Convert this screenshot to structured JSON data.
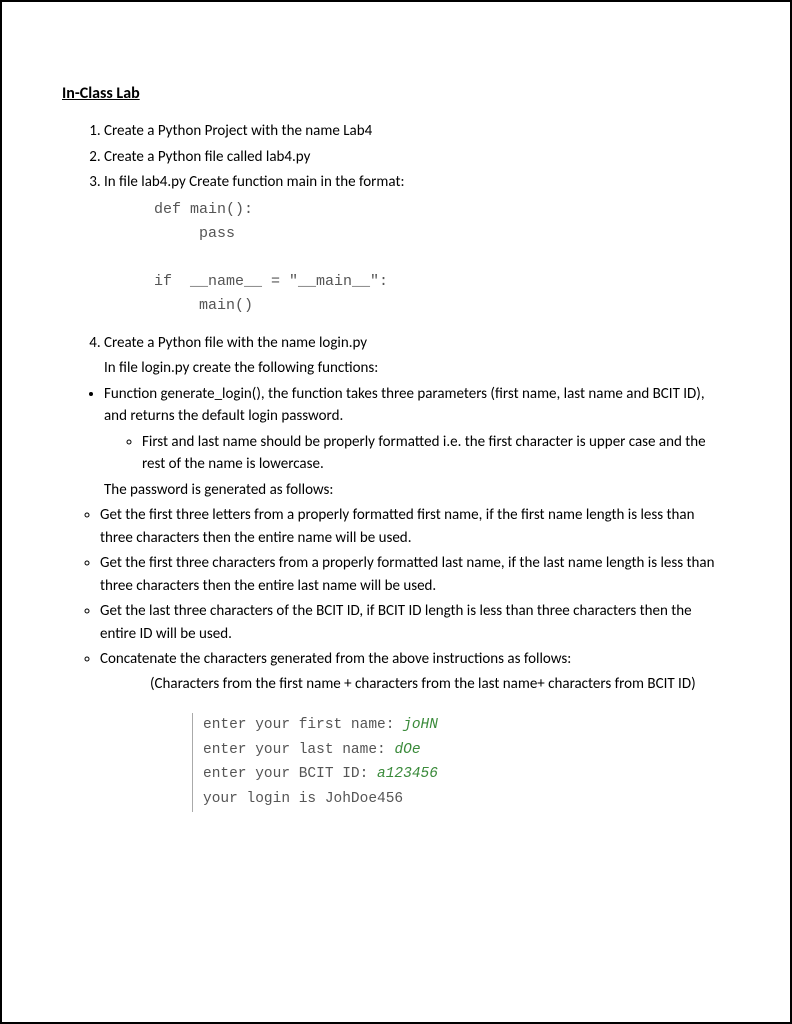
{
  "title": "In-Class Lab",
  "items": {
    "i1": "Create a Python Project with the name Lab4",
    "i2": "Create a Python file called lab4.py",
    "i3": "In file lab4.py Create function main in the format:",
    "code": "def main():\n     pass\n\nif  __name__ = \"__main__\":\n     main()",
    "i4": "Create a Python file with the name login.py",
    "i4sub": "In file login.py create the following functions:"
  },
  "bullet": "Function generate_login(), the function takes three parameters (first name, last name and BCIT ID), and returns the default login password.",
  "sub1": "First and last name should be properly formatted i.e. the first character is upper case and the rest of the name is lowercase.",
  "pwHeading": "The password is generated as follows:",
  "pw": {
    "a": "Get the first three letters from a properly formatted first name, if the first name length is less than three characters then the entire name will be used.",
    "b": "Get the first three characters from a properly formatted last name, if the last name length is less than three characters then the entire last name will be used.",
    "c": "Get the last three characters of the BCIT ID, if BCIT ID length is less than three characters then the entire ID will be used.",
    "d": "Concatenate the characters generated from the above instructions as follows:",
    "dnote": "(Characters from the first name + characters from the last name+ characters from BCIT ID)"
  },
  "terminal": {
    "l1a": "enter  your first name: ",
    "l1b": "joHN",
    "l2a": "enter your last name: ",
    "l2b": "dOe",
    "l3a": " enter your BCIT ID: ",
    "l3b": "a123456",
    "l4": "your login is  JohDoe456"
  }
}
